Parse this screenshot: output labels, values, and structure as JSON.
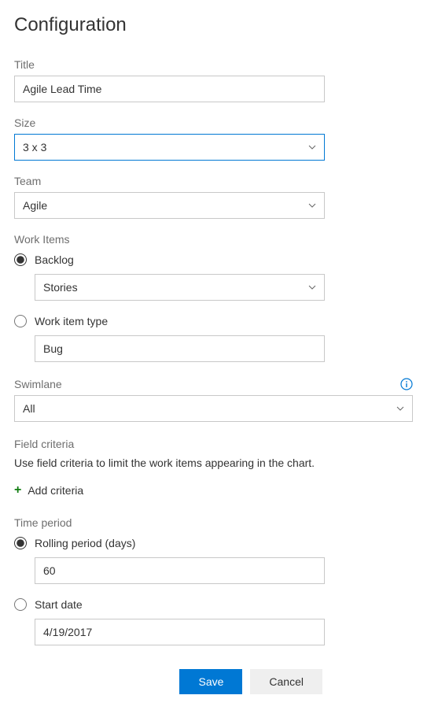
{
  "page": {
    "title": "Configuration"
  },
  "fields": {
    "title": {
      "label": "Title",
      "value": "Agile Lead Time"
    },
    "size": {
      "label": "Size",
      "value": "3 x 3"
    },
    "team": {
      "label": "Team",
      "value": "Agile"
    }
  },
  "workItems": {
    "label": "Work Items",
    "backlog": {
      "label": "Backlog",
      "value": "Stories"
    },
    "workItemType": {
      "label": "Work item type",
      "value": "Bug"
    }
  },
  "swimlane": {
    "label": "Swimlane",
    "value": "All"
  },
  "fieldCriteria": {
    "label": "Field criteria",
    "description": "Use field criteria to limit the work items appearing in the chart.",
    "addLabel": "Add criteria"
  },
  "timePeriod": {
    "label": "Time period",
    "rolling": {
      "label": "Rolling period (days)",
      "value": "60"
    },
    "startDate": {
      "label": "Start date",
      "value": "4/19/2017"
    }
  },
  "buttons": {
    "save": "Save",
    "cancel": "Cancel"
  }
}
